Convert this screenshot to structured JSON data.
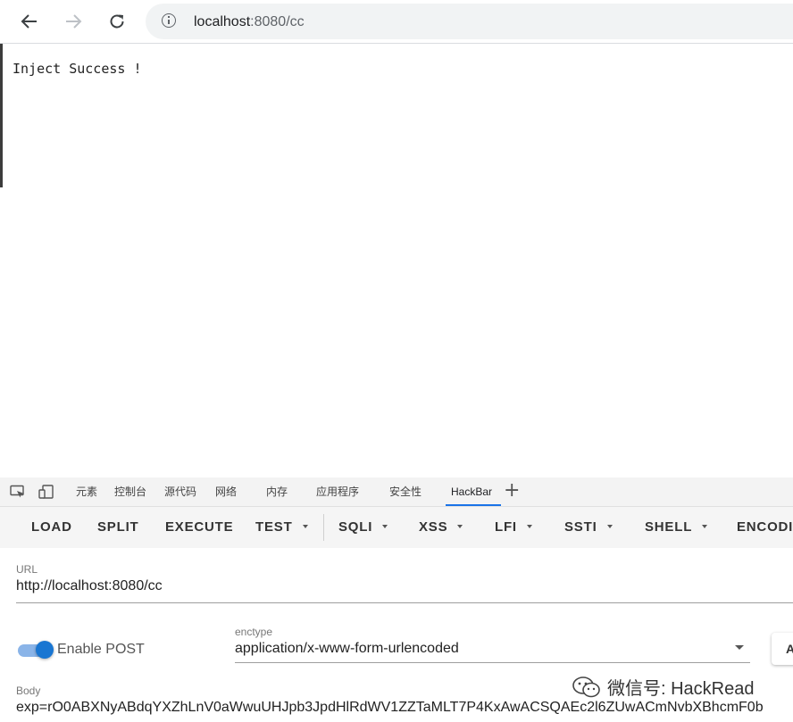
{
  "browser": {
    "url_host": "localhost",
    "url_rest": ":8080/cc"
  },
  "page": {
    "text": "Inject Success !"
  },
  "devtools": {
    "tabs": [
      "元素",
      "控制台",
      "源代码",
      "网络",
      "内存",
      "应用程序",
      "安全性",
      "HackBar"
    ],
    "active_tab": "HackBar",
    "add_tab_label": "+"
  },
  "hackbar": {
    "buttons": [
      {
        "label": "LOAD",
        "dropdown": false
      },
      {
        "label": "SPLIT",
        "dropdown": false
      },
      {
        "label": "EXECUTE",
        "dropdown": false
      },
      {
        "label": "TEST",
        "dropdown": true
      },
      {
        "label": "SQLI",
        "dropdown": true
      },
      {
        "label": "XSS",
        "dropdown": true
      },
      {
        "label": "LFI",
        "dropdown": true
      },
      {
        "label": "SSTI",
        "dropdown": true
      },
      {
        "label": "SHELL",
        "dropdown": true
      },
      {
        "label": "ENCODIN",
        "dropdown": false
      }
    ],
    "url_label": "URL",
    "url_value": "http://localhost:8080/cc",
    "enable_post_label": "Enable POST",
    "enable_post": true,
    "enctype_label": "enctype",
    "enctype_value": "application/x-www-form-urlencoded",
    "apply_label": "A",
    "body_label": "Body",
    "body_value": "exp=rO0ABXNyABdqYXZhLnV0aWwuUHJpb3JpdHlRdWV1ZZTaMLT7P4KxAwACSQAEc2l6ZUwACmNvbXBhcmF0b"
  },
  "watermark": {
    "text": "微信号: HackRead"
  },
  "colors": {
    "accent": "#1a73e8",
    "toggle_on": "#1976d2"
  }
}
